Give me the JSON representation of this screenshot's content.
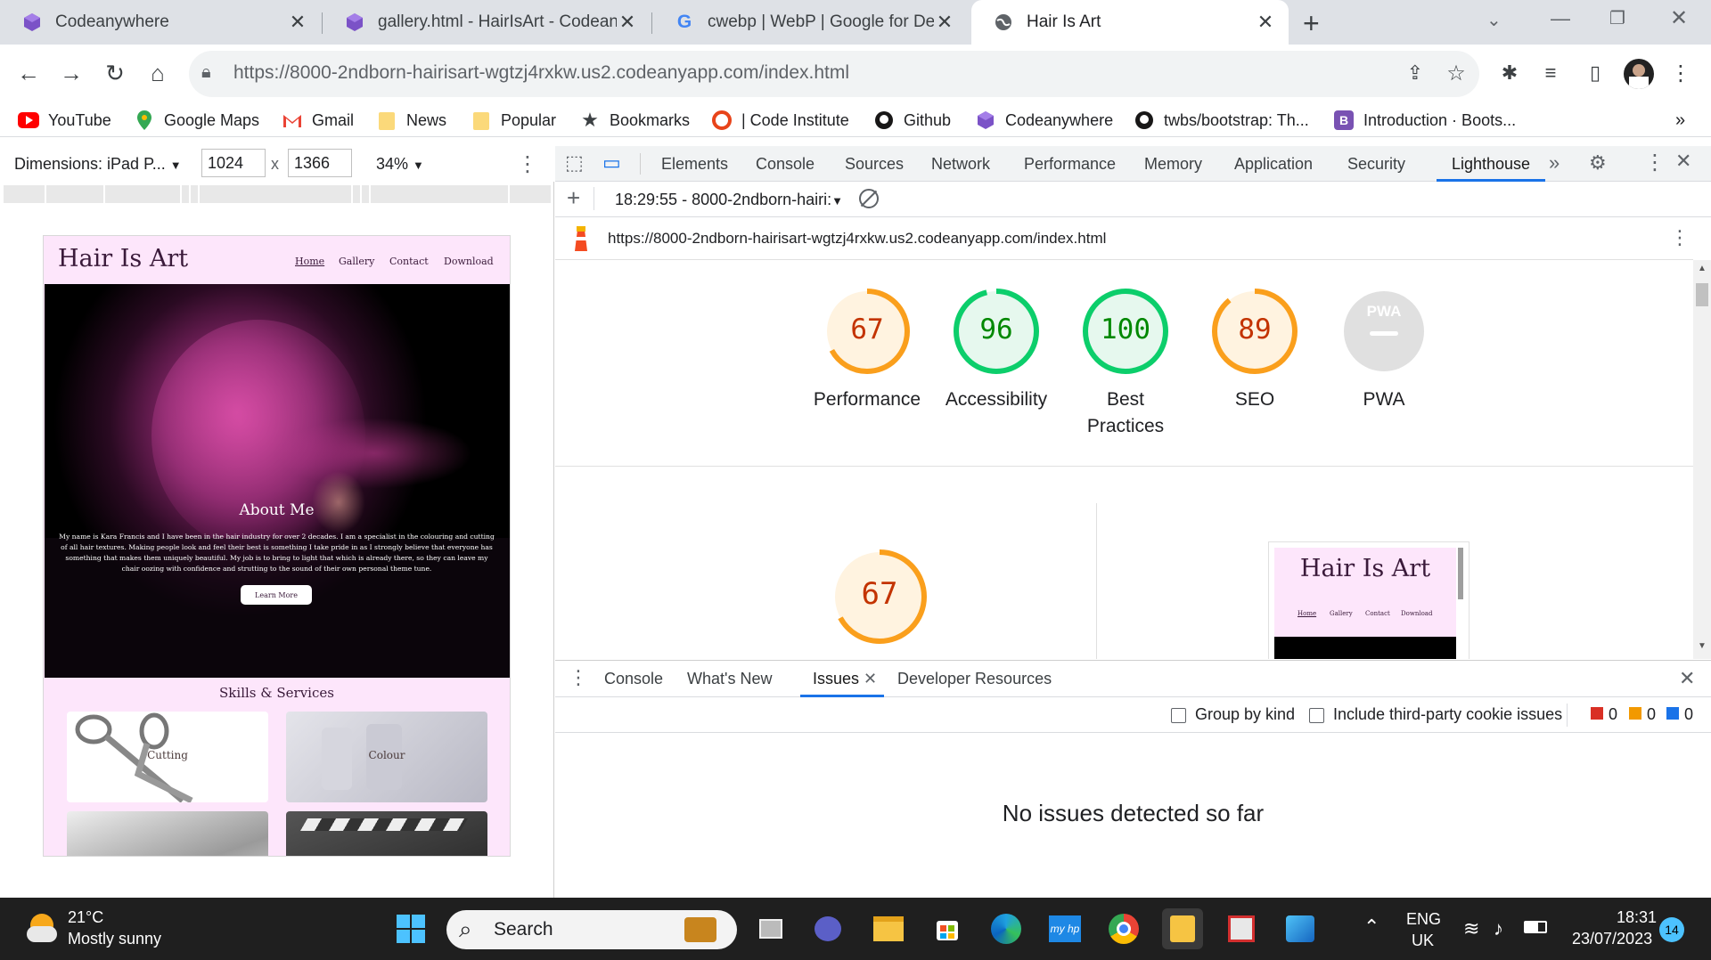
{
  "browser": {
    "tabs": [
      {
        "title": "Codeanywhere",
        "favicon": "codeanywhere-icon",
        "active": false
      },
      {
        "title": "gallery.html - HairIsArt - Codeany",
        "favicon": "codeanywhere-icon",
        "active": false
      },
      {
        "title": "cwebp  |  WebP  |  Google for De",
        "favicon": "google-icon",
        "active": false
      },
      {
        "title": "Hair Is Art",
        "favicon": "globe-icon",
        "active": true
      }
    ],
    "url_host": "https://8000-2ndborn-hairisart-wgtzj4rxkw.us2.codeanyapp.com",
    "url_path": "/index.html",
    "bookmarks": [
      {
        "label": "YouTube",
        "icon": "youtube-icon"
      },
      {
        "label": "Google Maps",
        "icon": "maps-pin-icon"
      },
      {
        "label": "Gmail",
        "icon": "gmail-icon"
      },
      {
        "label": "News",
        "icon": "folder-icon"
      },
      {
        "label": "Popular",
        "icon": "folder-icon"
      },
      {
        "label": "Bookmarks",
        "icon": "star-icon"
      },
      {
        "label": "| Code Institute",
        "icon": "code-institute-icon"
      },
      {
        "label": "Github",
        "icon": "github-icon"
      },
      {
        "label": "Codeanywhere",
        "icon": "codeanywhere-icon"
      },
      {
        "label": "twbs/bootstrap: Th...",
        "icon": "github-icon"
      },
      {
        "label": "Introduction · Boots...",
        "icon": "bootstrap-icon"
      }
    ],
    "more_bookmarks": "»"
  },
  "device_toolbar": {
    "dimensions_label": "Dimensions: iPad P...",
    "width": "1024",
    "times": "x",
    "height": "1366",
    "zoom": "34%"
  },
  "preview_site": {
    "title": "Hair Is Art",
    "nav": [
      "Home",
      "Gallery",
      "Contact",
      "Download"
    ],
    "about_title": "About Me",
    "about_text": "My name is Kara Francis and I have been in the hair industry for over 2 decades. I am a specialist in the colouring and cutting of all hair textures. Making people look and feel their best is something I take pride in as I strongly believe that everyone has something that makes them uniquely beautiful. My job is to bring to light that which is already there, so they can leave my chair oozing with confidence and strutting to the sound of their own personal theme tune.",
    "learn_more": "Learn More",
    "skills_title": "Skills & Services",
    "services": [
      "Cutting",
      "Colour"
    ]
  },
  "devtools": {
    "tabs": [
      "Elements",
      "Console",
      "Sources",
      "Network",
      "Performance",
      "Memory",
      "Application",
      "Security",
      "Lighthouse"
    ],
    "active_tab": "Lighthouse",
    "more": "»",
    "report_selector": "18:29:55 - 8000-2ndborn-hairi:",
    "report_url": "https://8000-2ndborn-hairisart-wgtzj4rxkw.us2.codeanyapp.com/index.html",
    "scores": [
      {
        "label": "Performance",
        "value": "67",
        "score": 0.67,
        "color": "#fa9f1c",
        "text_color": "#c33300",
        "bg": "#fff3e0"
      },
      {
        "label": "Accessibility",
        "value": "96",
        "score": 0.96,
        "color": "#0cce6b",
        "text_color": "#008800",
        "bg": "#e6f8ee"
      },
      {
        "label": "Best Practices",
        "value": "100",
        "score": 1.0,
        "color": "#0cce6b",
        "text_color": "#008800",
        "bg": "#e6f8ee"
      },
      {
        "label": "SEO",
        "value": "89",
        "score": 0.89,
        "color": "#fa9f1c",
        "text_color": "#c33300",
        "bg": "#fff3e0"
      },
      {
        "label": "PWA",
        "value": "PWA",
        "score": 0,
        "color": "#cccccc",
        "text_color": "#ffffff",
        "bg": "#e0e0e0"
      }
    ],
    "detail_score": {
      "value": "67",
      "score": 0.67
    },
    "thumb_title": "Hair Is Art",
    "thumb_nav": [
      "Home",
      "Gallery",
      "Contact",
      "Download"
    ]
  },
  "drawer": {
    "tabs": [
      "Console",
      "What's New",
      "Issues",
      "Developer Resources"
    ],
    "active_tab": "Issues",
    "group_by_kind": "Group by kind",
    "include_third_party": "Include third-party cookie issues",
    "counts": [
      "0",
      "0",
      "0"
    ],
    "empty_message": "No issues detected so far"
  },
  "taskbar": {
    "weather_temp": "21°C",
    "weather_desc": "Mostly sunny",
    "search_placeholder": "Search",
    "lang_top": "ENG",
    "lang_bottom": "UK",
    "time": "18:31",
    "date": "23/07/2023",
    "notifications": "14"
  }
}
